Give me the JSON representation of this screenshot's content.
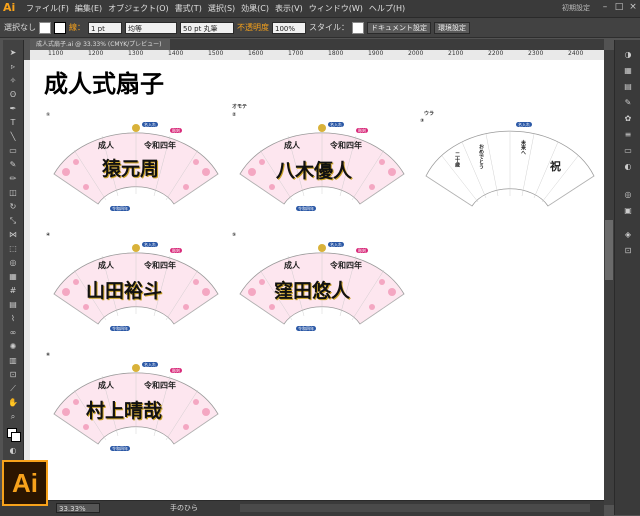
{
  "menubar": {
    "logo": "Ai",
    "items": [
      "ファイル(F)",
      "編集(E)",
      "オブジェクト(O)",
      "書式(T)",
      "選択(S)",
      "効果(C)",
      "表示(V)",
      "ウィンドウ(W)",
      "ヘルプ(H)"
    ],
    "workspace": "初期設定"
  },
  "control_bar": {
    "selection": "選択なし",
    "stroke_label": "線：",
    "stroke_weight": "1 pt",
    "stroke_style": "均等",
    "brush": "50 pt 丸筆",
    "opacity_label": "不透明度",
    "opacity_value": "100%",
    "style_label": "スタイル：",
    "doc_setup": "ドキュメント設定",
    "prefs": "環境設定"
  },
  "document": {
    "tab": "成人式扇子.ai @ 33.33% (CMYK/プレビュー)"
  },
  "ruler": {
    "ticks": [
      "1100",
      "1200",
      "1300",
      "1400",
      "1500",
      "1600",
      "1700",
      "1800",
      "1900",
      "2000",
      "2100",
      "2200",
      "2300",
      "2400"
    ]
  },
  "artboard": {
    "title": "成人式扇子",
    "omote_label": "オモテ",
    "ura_label": "ウラ",
    "header_text": "成人",
    "subtitle": "令和四年",
    "fans": [
      {
        "num": "①",
        "name": "猿元周"
      },
      {
        "num": "②",
        "name": "八木優人"
      },
      {
        "num": "④",
        "name": "山田裕斗"
      },
      {
        "num": "⑤",
        "name": "窪田悠人"
      },
      {
        "num": "⑥",
        "name": "村上晴哉"
      }
    ],
    "ura_num": "③",
    "ura_lines": [
      "二十歳",
      "おめでとう",
      "未来へ",
      "祝"
    ],
    "badge_labels": [
      "名入れ",
      "彫刻",
      "令和四年"
    ]
  },
  "status": {
    "zoom": "33.33%",
    "tool": "手のひら"
  }
}
